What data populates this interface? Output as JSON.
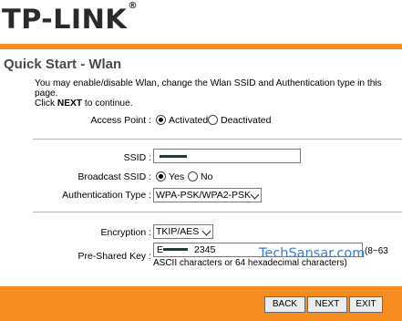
{
  "brand": {
    "name": "TP-LINK",
    "reg": "®"
  },
  "page": {
    "title": "Quick Start - Wlan"
  },
  "intro": {
    "line1": "You may enable/disable Wlan, change the Wlan SSID and Authentication type in this page.",
    "click": "Click ",
    "next_word": "NEXT",
    "to_continue": " to continue."
  },
  "access_point": {
    "label": "Access Point :",
    "options": [
      {
        "label": "Activated",
        "selected": true
      },
      {
        "label": "Deactivated",
        "selected": false
      }
    ]
  },
  "ssid": {
    "label": "SSID :"
  },
  "broadcast": {
    "label": "Broadcast SSID :",
    "options": [
      {
        "label": "Yes",
        "selected": true
      },
      {
        "label": "No",
        "selected": false
      }
    ]
  },
  "auth": {
    "label": "Authentication Type :",
    "value": "WPA-PSK/WPA2-PSK"
  },
  "encryption": {
    "label": "Encryption :",
    "value": "TKIP/AES"
  },
  "psk": {
    "label": "Pre-Shared Key :",
    "value_prefix": "E",
    "value_suffix": "2345",
    "hint_right": "(8~63",
    "hint_line2": "ASCII characters or 64 hexadecimal characters)"
  },
  "watermark": "TechSansar.com",
  "buttons": {
    "back": "BACK",
    "next": "NEXT",
    "exit": "EXIT"
  },
  "colors": {
    "accent": "#f68b1f",
    "watermark": "#3a7ad8"
  }
}
